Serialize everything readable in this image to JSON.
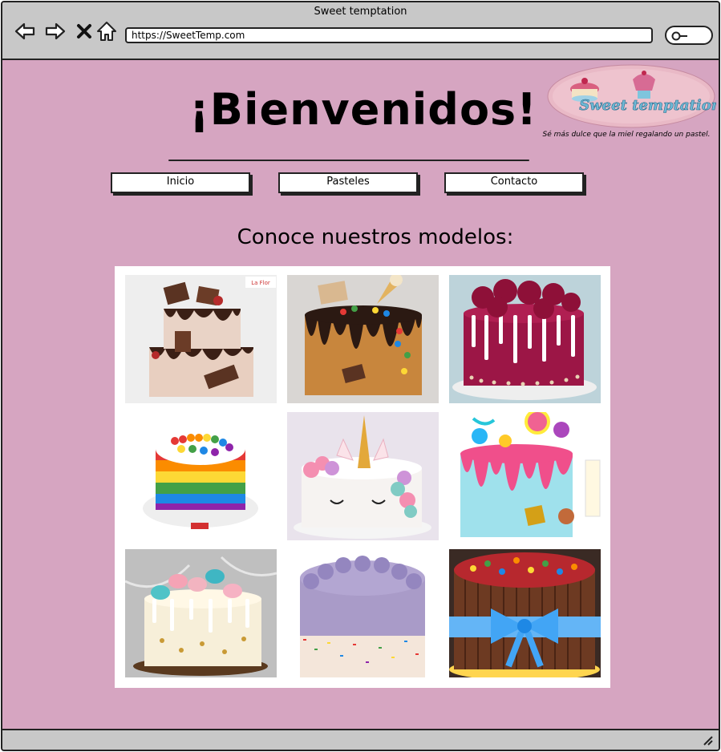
{
  "window": {
    "title": "Sweet temptation"
  },
  "browser": {
    "url": "https://SweetTemp.com",
    "nav_icons": [
      "back-arrow-icon",
      "forward-arrow-icon",
      "close-icon",
      "home-icon"
    ],
    "search_icon": "search-icon"
  },
  "brand": {
    "logo_text": "Sweet temptation",
    "tagline": "Sé más dulce que la miel regalando un pastel."
  },
  "page": {
    "heading": "¡Bienvenidos!",
    "subheading": "Conoce nuestros modelos:"
  },
  "nav": {
    "items": [
      {
        "label": "Inicio"
      },
      {
        "label": "Pasteles"
      },
      {
        "label": "Contacto"
      }
    ]
  },
  "gallery": {
    "images": [
      {
        "name": "chocolate-drip-cake-image",
        "badge": "La Flor"
      },
      {
        "name": "ice-cream-candy-drip-cake-image"
      },
      {
        "name": "magenta-rosette-cake-image"
      },
      {
        "name": "rainbow-bubble-cake-image"
      },
      {
        "name": "unicorn-cake-image"
      },
      {
        "name": "pink-candy-drip-cake-image"
      },
      {
        "name": "macaron-drip-cake-image"
      },
      {
        "name": "lavender-sprinkle-cake-image"
      },
      {
        "name": "kitkat-candy-cake-image"
      }
    ]
  },
  "colors": {
    "page_background": "#d6a5c1",
    "chrome": "#c8c8c8",
    "border": "#222222"
  }
}
